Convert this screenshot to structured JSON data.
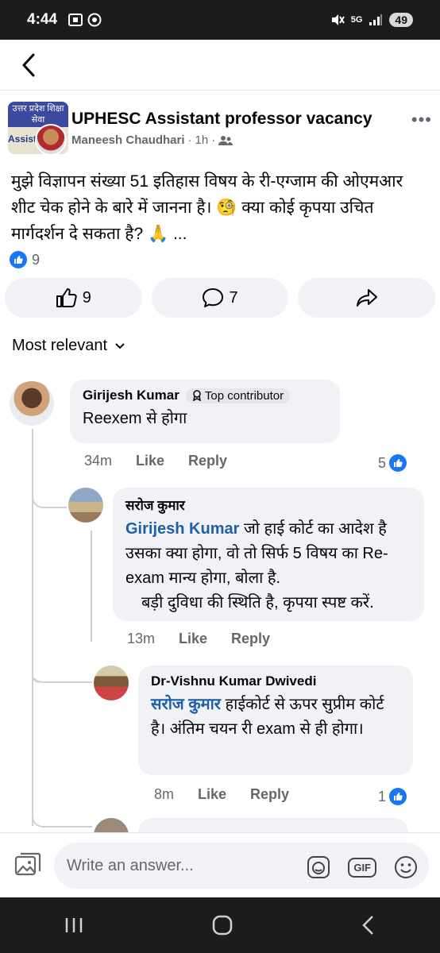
{
  "status_bar": {
    "time": "4:44",
    "battery": "49",
    "network": "5G"
  },
  "post": {
    "group_name": "UPHESC Assistant professor vacancy",
    "author": "Maneesh Chaudhari",
    "time": "1h",
    "dot": "·",
    "text": "मुझे विज्ञापन संख्या 51 इतिहास विषय के री-एग्जाम की ओएमआर शीट चेक होने के बारे में जानना है। 🧐 क्या कोई कृपया उचित मार्गदर्शन दे सकता है? 🙏 ...",
    "reaction_count": "9",
    "like_count": "9",
    "comment_count": "7",
    "group_avatar_top": "उत्तर प्रदेश शिक्षा सेवा",
    "group_avatar_side": "Assistant"
  },
  "sort_label": "Most relevant",
  "comments": [
    {
      "name": "Girijesh Kumar",
      "badge": "Top contributor",
      "text": "Reexem से होगा",
      "time": "34m",
      "like": "Like",
      "reply": "Reply",
      "reactions": "5"
    },
    {
      "name": "सरोज कुमार",
      "mention": "Girijesh Kumar",
      "text": " जो हाई कोर्ट का आदेश है उसका क्या होगा, वो तो सिर्फ 5 विषय का Re-exam मान्य होगा, बोला है.",
      "text2": "बड़ी दुविधा की स्थिति है, कृपया स्पष्ट करें.",
      "time": "13m",
      "like": "Like",
      "reply": "Reply"
    },
    {
      "name": "Dr-Vishnu Kumar Dwivedi",
      "mention": "सरोज कुमार",
      "text": " हाईकोर्ट से ऊपर सुप्रीम कोर्ट है। अंतिम चयन री exam से ही होगा।",
      "time": "8m",
      "like": "Like",
      "reply": "Reply",
      "reactions": "1"
    }
  ],
  "composer": {
    "placeholder": "Write an answer...",
    "gif": "GIF"
  },
  "colors": {
    "facebook_blue": "#1877f2",
    "bubble_bg": "#f0f2f5",
    "mention": "#1d5fa8"
  }
}
